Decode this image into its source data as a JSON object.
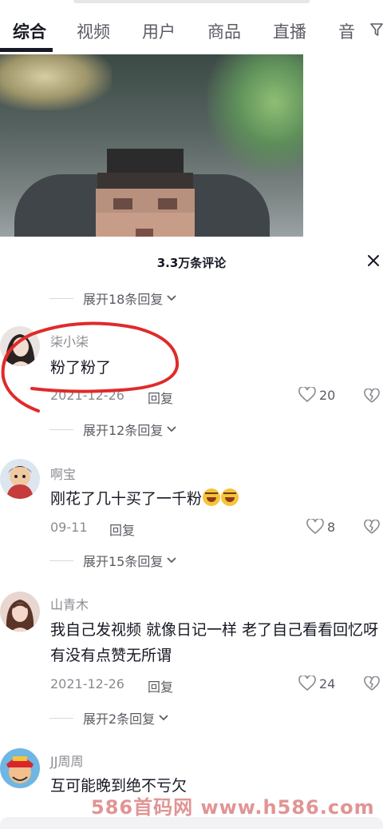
{
  "tabs": [
    {
      "label": "综合",
      "active": true
    },
    {
      "label": "视频"
    },
    {
      "label": "用户"
    },
    {
      "label": "商品"
    },
    {
      "label": "直播"
    },
    {
      "label": "音"
    }
  ],
  "comments_header": {
    "title": "3.3万条评论"
  },
  "expand_replies": [
    {
      "label": "展开18条回复"
    },
    {
      "label": "展开12条回复"
    },
    {
      "label": "展开15条回复"
    },
    {
      "label": "展开2条回复"
    }
  ],
  "comments": [
    {
      "username": "柒小柒",
      "text": "粉了粉了",
      "date": "2021-12-26",
      "reply_label": "回复",
      "likes": "20"
    },
    {
      "username": "啊宝",
      "text": "刚花了几十买了一千粉",
      "emoji": [
        "laugh-cry-emoji",
        "laugh-cry-emoji"
      ],
      "date": "09-11",
      "reply_label": "回复",
      "likes": "8"
    },
    {
      "username": "山青木",
      "text": "我自己发视频 就像日记一样 老了自己看看回忆呀 有没有点赞无所谓",
      "date": "2021-12-26",
      "reply_label": "回复",
      "likes": "24"
    },
    {
      "username": "JJ周周",
      "text": "互可能晚到绝不亏欠"
    }
  ],
  "watermark": "586首码网 www.h586.com",
  "icons": [
    "filter-icon",
    "close-icon",
    "chevron-down-icon",
    "heart-icon",
    "broken-heart-icon"
  ],
  "colors": {
    "annotation_red": "#e02a2a",
    "text_primary": "#161823",
    "text_secondary": "#8a8b91"
  }
}
